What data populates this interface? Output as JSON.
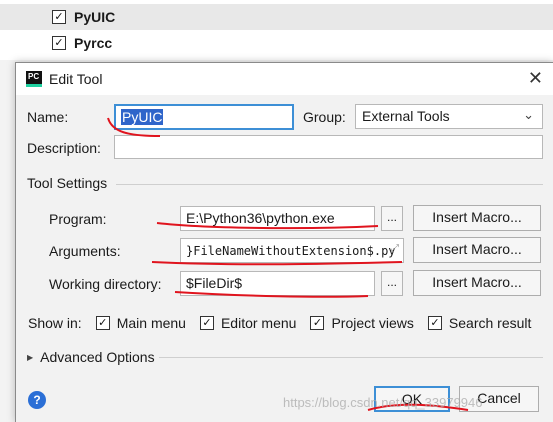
{
  "background_list": [
    {
      "label": "PyUIC",
      "checked": true
    },
    {
      "label": "Pyrcc",
      "checked": true
    }
  ],
  "dialog": {
    "app_icon_text": "PC",
    "title": "Edit Tool",
    "name_label": "Name:",
    "name_value": "PyUIC",
    "group_label": "Group:",
    "group_value": "External Tools",
    "description_label": "Description:",
    "description_value": "",
    "tool_settings_label": "Tool Settings",
    "program_label": "Program:",
    "program_value": "E:\\Python36\\python.exe",
    "arguments_label": "Arguments:",
    "arguments_value": "}FileNameWithoutExtension$.py",
    "working_dir_label": "Working directory:",
    "working_dir_value": "$FileDir$",
    "browse_label": "...",
    "insert_macro_label": "Insert Macro...",
    "show_in_label": "Show in:",
    "show_in_options": [
      {
        "label": "Main menu",
        "checked": true
      },
      {
        "label": "Editor menu",
        "checked": true
      },
      {
        "label": "Project views",
        "checked": true
      },
      {
        "label": "Search result",
        "checked": true
      }
    ],
    "advanced_label": "Advanced Options",
    "ok_label": "OK",
    "cancel_label": "Cancel",
    "help_icon_text": "?"
  },
  "watermark": "https://blog.csdn.net/qq_33979946",
  "colors": {
    "selection": "#2f65ca",
    "focus_border": "#3d8fd6",
    "annotation_red": "#e0141e",
    "help_blue": "#2b6fd6"
  },
  "icons": {
    "checkbox": "check-mark",
    "close": "close-x",
    "expand": "triangle-right",
    "dropdown": "chevron-down",
    "help": "question-circle"
  }
}
